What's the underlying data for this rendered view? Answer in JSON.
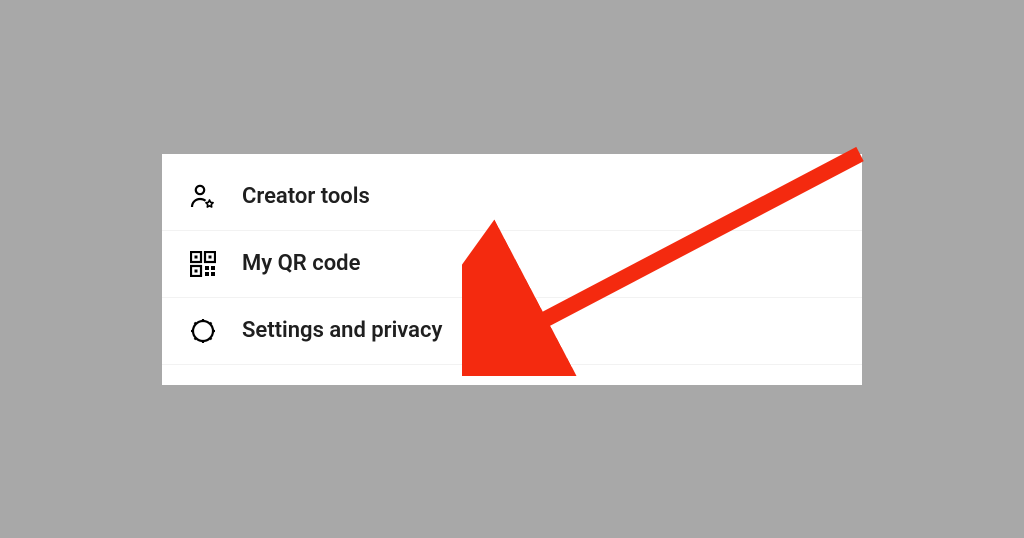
{
  "menu": {
    "items": [
      {
        "label": "Creator tools",
        "icon": "person-star-icon"
      },
      {
        "label": "My QR code",
        "icon": "qr-code-icon"
      },
      {
        "label": "Settings and privacy",
        "icon": "gear-icon"
      }
    ]
  },
  "annotation": {
    "color": "#f42a0f",
    "target": "settings-and-privacy"
  }
}
